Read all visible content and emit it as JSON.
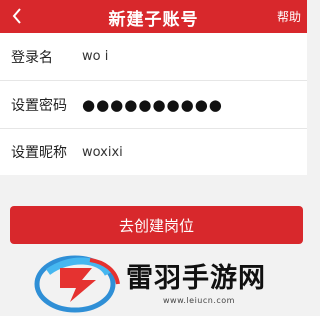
{
  "header": {
    "title": "新建子账号",
    "help_label": "帮助",
    "back_icon": "chevron-left-icon"
  },
  "form": {
    "rows": [
      {
        "label": "登录名",
        "value": "wo  i"
      },
      {
        "label": "设置密码",
        "value": "●●●●●●●●●●"
      },
      {
        "label": "设置昵称",
        "value": "woxixi"
      }
    ]
  },
  "cta": {
    "label": "去创建岗位"
  },
  "watermark": {
    "name": "雷羽手游网",
    "url": "www.leiucn.com"
  },
  "colors": {
    "accent": "#d8282c",
    "background": "#f2f2f2"
  }
}
